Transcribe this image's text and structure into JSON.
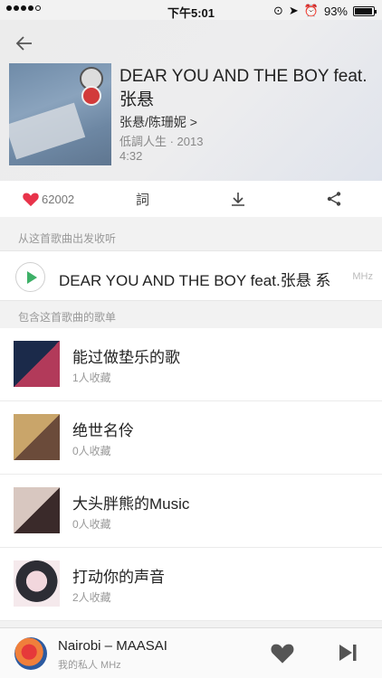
{
  "status": {
    "time": "下午5:01",
    "battery": "93%",
    "battery_fraction": 0.93
  },
  "song": {
    "title": "DEAR YOU AND THE BOY feat.张悬",
    "artists": "张悬/陈珊妮 >",
    "album": "低調人生 · 2013",
    "duration": "4:32"
  },
  "actions": {
    "like_count": "62002",
    "lyric_label": "詞"
  },
  "sections": {
    "radio_label": "从这首歌曲出发收听",
    "playlists_label": "包含这首歌曲的歌单"
  },
  "radio": {
    "title": "DEAR YOU AND THE BOY feat.张悬 系",
    "badge": "MHz"
  },
  "playlists": [
    {
      "title": "能过做垫乐的歌",
      "subtitle": "1人收藏"
    },
    {
      "title": "绝世名伶",
      "subtitle": "0人收藏"
    },
    {
      "title": "大头胖熊的Music",
      "subtitle": "0人收藏"
    },
    {
      "title": "打动你的声音",
      "subtitle": "2人收藏"
    }
  ],
  "now_playing": {
    "title": "Nairobi – MAASAI",
    "subtitle": "我的私人 MHz"
  },
  "colors": {
    "accent_green": "#3db067",
    "like_red": "#e8334a"
  },
  "icons": [
    "back-arrow-icon",
    "heart-icon",
    "lyrics-icon",
    "download-icon",
    "share-icon",
    "play-icon",
    "next-track-icon"
  ]
}
